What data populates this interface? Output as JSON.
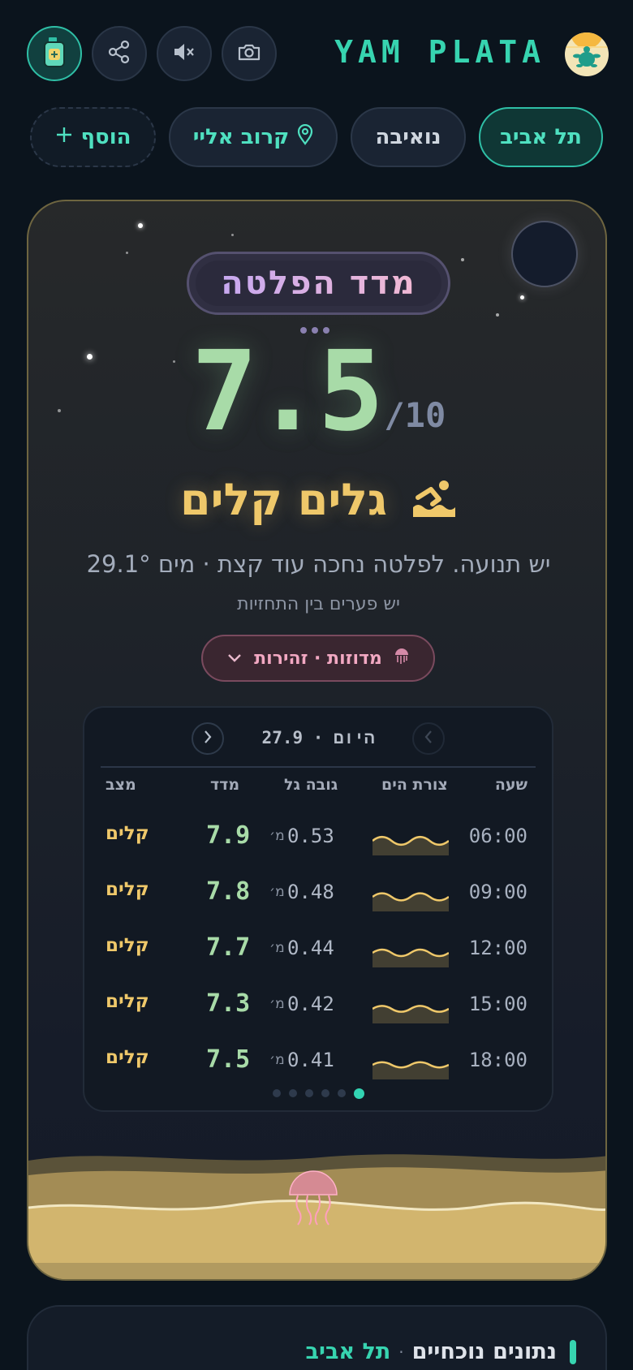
{
  "app": {
    "title": "YAM PLATA"
  },
  "toolbar": {
    "buttons": [
      "sunscreen-icon",
      "share-icon",
      "mute-icon",
      "camera-icon"
    ]
  },
  "tabs": {
    "tel_aviv": "תל אביב",
    "nuweiba": "נואיבה",
    "near_me": "קרוב אליי",
    "add": "הוסף"
  },
  "hero": {
    "index_title": "מדד הפלטה",
    "score": "7.5",
    "out_of": "/10",
    "condition": "גלים קלים",
    "description": "יש תנועה. לפלטה נחכה עוד קצת · מים 29.1°",
    "subtext": "יש פערים בין התחזיות",
    "alert": "מדוזות · זהירות"
  },
  "forecast": {
    "header": "היום · 27.9",
    "columns": {
      "time": "שעה",
      "sea_shape": "צורת הים",
      "wave_height": "גובה גל",
      "index": "מדד",
      "status": "מצב"
    },
    "unit": "מ׳",
    "rows": [
      {
        "time": "06:00",
        "wave_height": "0.53",
        "index": "7.9",
        "status": "קלים"
      },
      {
        "time": "09:00",
        "wave_height": "0.48",
        "index": "7.8",
        "status": "קלים"
      },
      {
        "time": "12:00",
        "wave_height": "0.44",
        "index": "7.7",
        "status": "קלים"
      },
      {
        "time": "15:00",
        "wave_height": "0.42",
        "index": "7.3",
        "status": "קלים"
      },
      {
        "time": "18:00",
        "wave_height": "0.41",
        "index": "7.5",
        "status": "קלים"
      }
    ],
    "pages": 6,
    "active_page": 6
  },
  "current": {
    "title": "נתונים נוכחיים",
    "separator": "·",
    "location": "תל אביב"
  },
  "colors": {
    "accent": "#37d4b0",
    "score": "#a8dba8",
    "condition": "#efc86a",
    "alert": "#f2a8c2"
  }
}
